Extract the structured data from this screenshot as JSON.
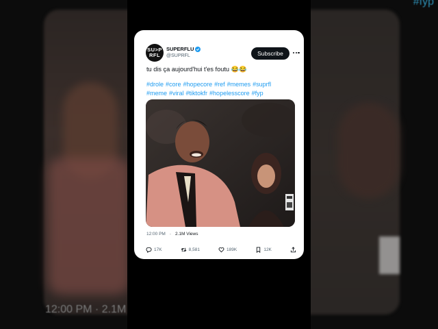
{
  "tweet": {
    "avatar_text_line1": "SU>P",
    "avatar_text_line2": "RFL",
    "display_name": "SUPERFLU",
    "handle": "@SUPRFL",
    "subscribe_label": "Subscribe",
    "text": "tu dis ça aujourd'hui t'es foutu 😂😂",
    "hashtags": [
      "#drole",
      "#core",
      "#hopecore",
      "#ref",
      "#memes",
      "#suprfl",
      "#meme",
      "#viral",
      "#tiktokfr",
      "#hopelesscore",
      "#fyp"
    ],
    "time": "12:00 PM",
    "views": "2.1M Views",
    "replies": "17K",
    "retweets": "8,581",
    "likes": "189K",
    "bookmarks": "12K"
  },
  "background": {
    "time_blur": "12:00 PM · 2.1M",
    "hashtag_blur": "#fyp"
  },
  "colors": {
    "link": "#1d9bf0",
    "verified": "#1d9bf0",
    "text": "#0f1419",
    "muted": "#536471"
  },
  "icons": [
    "verified-badge-icon",
    "more-icon",
    "reply-icon",
    "retweet-icon",
    "like-icon",
    "bookmark-icon",
    "share-icon"
  ]
}
